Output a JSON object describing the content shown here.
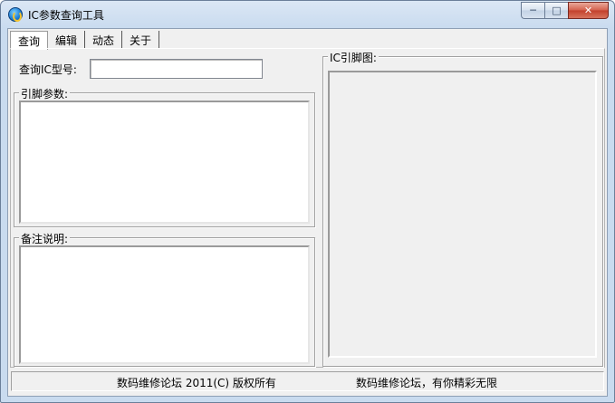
{
  "window": {
    "title": "IC参数查询工具",
    "controls": {
      "minimize": "─",
      "maximize": "□",
      "close": "✕"
    },
    "icons": {
      "app": "app-logo-icon"
    }
  },
  "tabs": [
    {
      "label": "查询",
      "active": true
    },
    {
      "label": "编辑",
      "active": false
    },
    {
      "label": "动态",
      "active": false
    },
    {
      "label": "关于",
      "active": false
    }
  ],
  "query": {
    "ic_model_label": "查询IC型号:",
    "ic_model_value": ""
  },
  "pin_params": {
    "title": "引脚参数:",
    "value": ""
  },
  "notes": {
    "title": "备注说明:",
    "value": ""
  },
  "pin_diagram": {
    "title": "IC引脚图:"
  },
  "status": {
    "left": "数码维修论坛 2011(C) 版权所有",
    "right": "数码维修论坛，有你精彩无限"
  },
  "colors": {
    "titlebar": "#c9dbef",
    "client": "#f0f0f0",
    "close_button": "#c2402b"
  }
}
